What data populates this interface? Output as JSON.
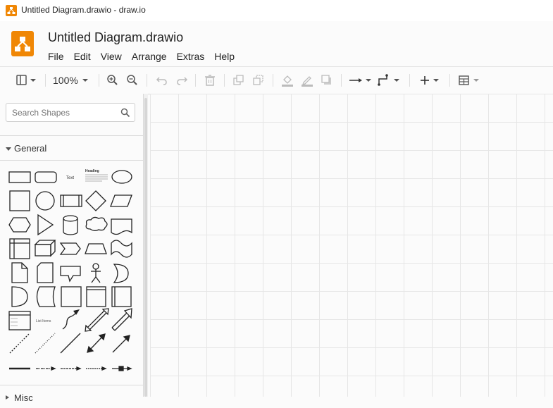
{
  "window": {
    "title": "Untitled Diagram.drawio - draw.io"
  },
  "header": {
    "doc_title": "Untitled Diagram.drawio"
  },
  "menu": [
    "File",
    "Edit",
    "View",
    "Arrange",
    "Extras",
    "Help"
  ],
  "toolbar": {
    "zoom": "100%"
  },
  "sidebar": {
    "search_placeholder": "Search Shapes",
    "sections": [
      "General",
      "Misc"
    ],
    "shape_texts": {
      "text": "Text",
      "heading": "Heading",
      "list_items": "List Items"
    }
  },
  "colors": {
    "brand": "#f08705",
    "grid": "#e6e6e6"
  }
}
